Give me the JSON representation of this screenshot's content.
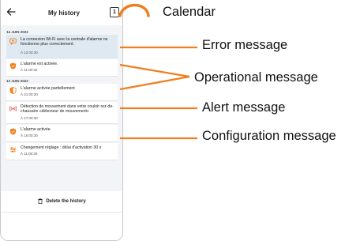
{
  "header": {
    "title": "My history",
    "calendar_day": "1"
  },
  "days": [
    {
      "date": "14 JUIN 2022",
      "events": [
        {
          "kind": "error",
          "icon": "message-error-icon",
          "text": "La connexion Wi-Fi avec la centrale d'alarme ne fonctionne plus correctement.",
          "time": "À 12:00:30"
        },
        {
          "kind": "operational",
          "icon": "shield-icon",
          "text": "L'alarme est activée.",
          "time": "À 11:00:30"
        }
      ]
    },
    {
      "date": "13 JUIN 2022",
      "events": [
        {
          "kind": "operational",
          "icon": "shield-half-icon",
          "text": "L'alarme activée partiellement",
          "time": "À 21:00:30"
        },
        {
          "kind": "alert",
          "icon": "motion-alert-icon",
          "text": "Détection de mouvement dans votre couloir rez-de-chaussée «détecteur de mouvement»",
          "time": "À 17:00:30"
        },
        {
          "kind": "operational",
          "icon": "shield-icon",
          "text": "L'alarme activée",
          "time": "À 16:00:30"
        },
        {
          "kind": "configuration",
          "icon": "settings-sliders-icon",
          "text": "Changement réglage : délai d'activation 30 s",
          "time": "À 11:00:30"
        }
      ]
    }
  ],
  "footer": {
    "delete_label": "Delete the history"
  },
  "annotations": {
    "calendar": "Calendar",
    "error": "Error message",
    "operational": "Operational message",
    "alert": "Alert message",
    "configuration": "Configuration message"
  },
  "colors": {
    "accent_orange": "#f07f1e",
    "alert_red": "#e0443a",
    "error_bg": "#dfe9f1",
    "list_bg": "#f2f4f7"
  }
}
